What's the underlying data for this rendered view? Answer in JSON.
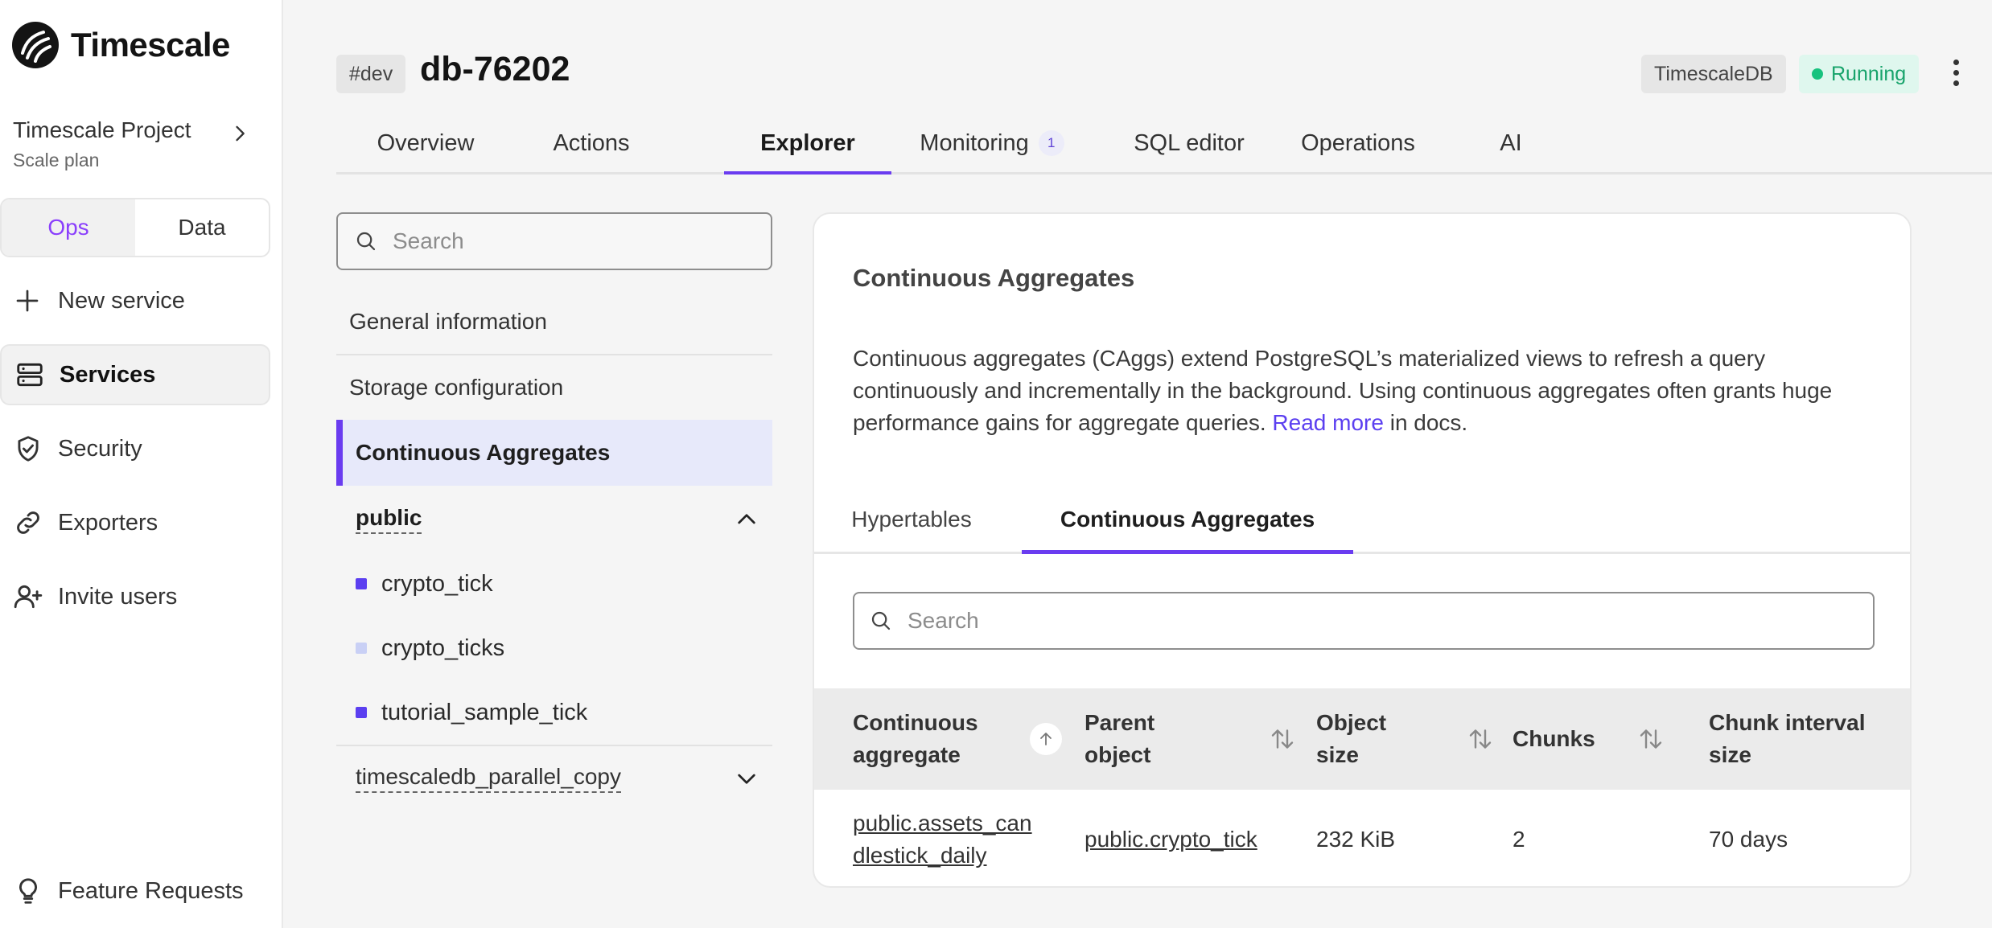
{
  "brand": {
    "name": "Timescale"
  },
  "project": {
    "name": "Timescale Project",
    "plan": "Scale plan"
  },
  "mode_toggle": {
    "ops": "Ops",
    "data": "Data",
    "active": "Ops"
  },
  "sidebar": {
    "items": [
      {
        "label": "New service",
        "icon": "plus-icon"
      },
      {
        "label": "Services",
        "icon": "server-icon",
        "active": true
      },
      {
        "label": "Security",
        "icon": "shield-check-icon"
      },
      {
        "label": "Exporters",
        "icon": "link-icon"
      },
      {
        "label": "Invite users",
        "icon": "user-plus-icon"
      }
    ],
    "footer": {
      "label": "Feature Requests",
      "icon": "lightbulb-icon"
    }
  },
  "service": {
    "env": "#dev",
    "name": "db-76202",
    "engine": "TimescaleDB",
    "status": "Running"
  },
  "tabs": [
    {
      "label": "Overview"
    },
    {
      "label": "Actions"
    },
    {
      "label": "Explorer",
      "active": true
    },
    {
      "label": "Monitoring",
      "count": "1"
    },
    {
      "label": "SQL editor"
    },
    {
      "label": "Operations"
    },
    {
      "label": "AI"
    }
  ],
  "explorer": {
    "search_placeholder": "Search",
    "nav": [
      {
        "label": "General information"
      },
      {
        "label": "Storage configuration"
      },
      {
        "label": "Continuous Aggregates",
        "active": true
      }
    ],
    "schemas": [
      {
        "name": "public",
        "expanded": true,
        "tables": [
          {
            "name": "crypto_tick",
            "color": "#5b3ff0"
          },
          {
            "name": "crypto_ticks",
            "color": "#c9d0f5"
          },
          {
            "name": "tutorial_sample_tick",
            "color": "#5b3ff0"
          }
        ]
      },
      {
        "name": "timescaledb_parallel_copy",
        "expanded": false
      }
    ]
  },
  "panel": {
    "title": "Continuous Aggregates",
    "desc_before": "Continuous aggregates (CAggs) extend PostgreSQL’s materialized views to refresh a query continuously and incrementally in the background. Using continuous aggregates often grants huge performance gains for aggregate queries. ",
    "desc_link": "Read more",
    "desc_after": " in docs.",
    "tabs": [
      {
        "label": "Hypertables"
      },
      {
        "label": "Continuous Aggregates",
        "active": true
      }
    ],
    "search_placeholder": "Search",
    "columns": [
      "Continuous aggregate",
      "Parent object",
      "Object size",
      "Chunks",
      "Chunk interval size"
    ],
    "rows": [
      {
        "aggregate": "public.assets_candlestick_daily",
        "aggregate_line1": "public.assets_can",
        "aggregate_line2": "dlestick_daily",
        "parent": "public.crypto_tick",
        "size": "232 KiB",
        "chunks": "2",
        "interval": "70 days"
      }
    ]
  },
  "colors": {
    "accent": "#6a3cf0",
    "running": "#17a36b",
    "ops_active": "#8a3ffc"
  }
}
